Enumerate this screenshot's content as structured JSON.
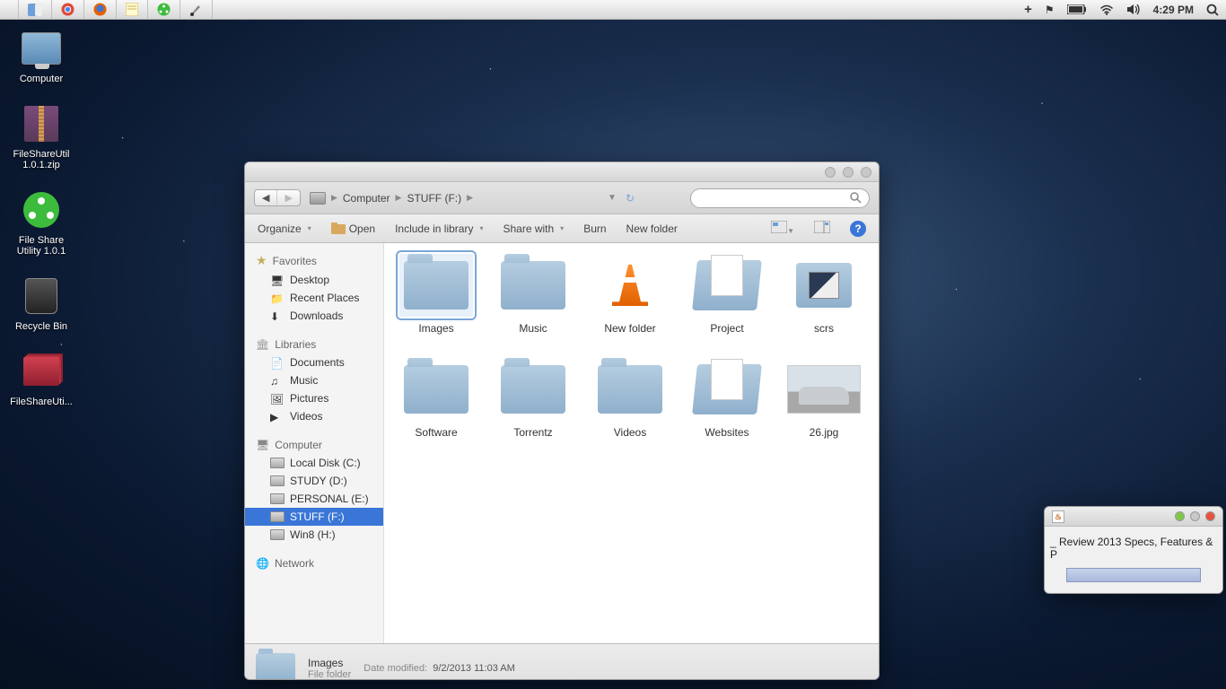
{
  "menubar": {
    "time": "4:29 PM"
  },
  "desktop": {
    "icons": [
      {
        "name": "Computer",
        "type": "computer"
      },
      {
        "name": "FileShareUtil 1.0.1.zip",
        "type": "archive"
      },
      {
        "name": "File Share Utility 1.0.1",
        "type": "share"
      },
      {
        "name": "Recycle Bin",
        "type": "bin"
      },
      {
        "name": "FileShareUti...",
        "type": "folder-red"
      }
    ]
  },
  "explorer": {
    "breadcrumb": {
      "root": "Computer",
      "current": "STUFF (F:)"
    },
    "toolbar": {
      "organize": "Organize",
      "open": "Open",
      "include": "Include in library",
      "share": "Share with",
      "burn": "Burn",
      "newfolder": "New folder"
    },
    "sidebar": {
      "favorites": {
        "label": "Favorites",
        "items": [
          "Desktop",
          "Recent Places",
          "Downloads"
        ]
      },
      "libraries": {
        "label": "Libraries",
        "items": [
          "Documents",
          "Music",
          "Pictures",
          "Videos"
        ]
      },
      "computer": {
        "label": "Computer",
        "items": [
          "Local Disk (C:)",
          "STUDY (D:)",
          "PERSONAL (E:)",
          "STUFF (F:)",
          "Win8 (H:)"
        ],
        "selected": "STUFF (F:)"
      },
      "network": {
        "label": "Network"
      }
    },
    "items": [
      {
        "name": "Images",
        "type": "folder",
        "selected": true
      },
      {
        "name": "Music",
        "type": "folder"
      },
      {
        "name": "New folder",
        "type": "vlc"
      },
      {
        "name": "Project",
        "type": "folder-docs"
      },
      {
        "name": "scrs",
        "type": "folder-scrs"
      },
      {
        "name": "Software",
        "type": "folder"
      },
      {
        "name": "Torrentz",
        "type": "folder"
      },
      {
        "name": "Videos",
        "type": "folder"
      },
      {
        "name": "Websites",
        "type": "folder-docs"
      },
      {
        "name": "26.jpg",
        "type": "image-car"
      }
    ],
    "status": {
      "name": "Images",
      "type": "File folder",
      "modified_label": "Date modified:",
      "modified_value": "9/2/2013 11:03 AM"
    }
  },
  "popup": {
    "text": "_ Review 2013 Specs, Features & P"
  }
}
